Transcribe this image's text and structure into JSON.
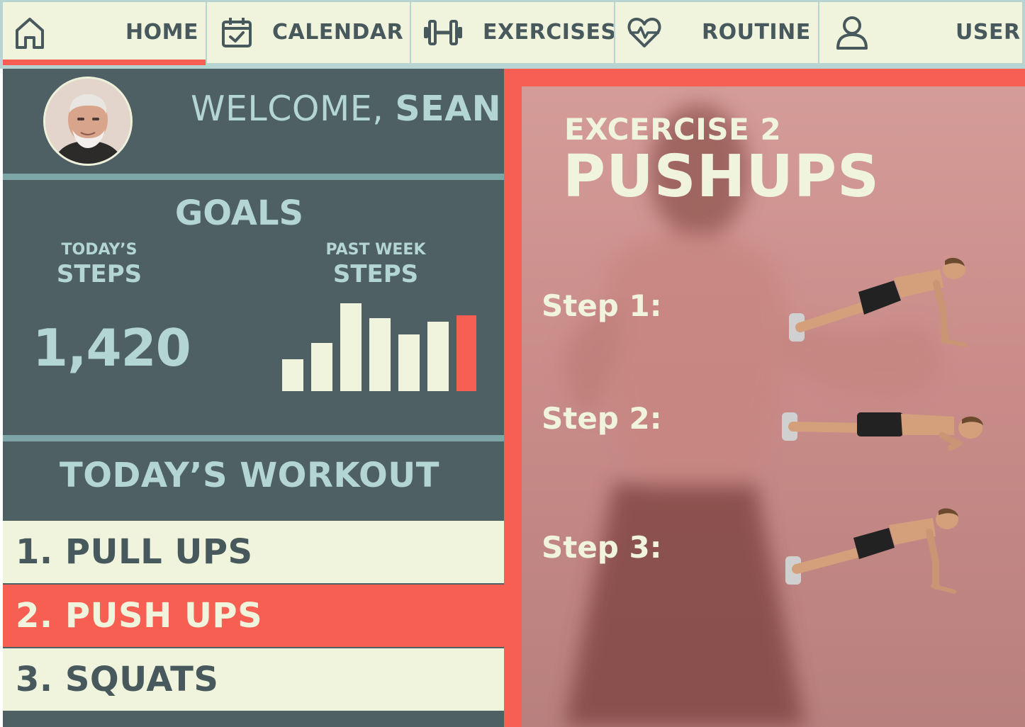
{
  "nav": {
    "tabs": [
      {
        "label": "HOME",
        "icon": "home-icon",
        "active": true
      },
      {
        "label": "CALENDAR",
        "icon": "calendar-check-icon",
        "active": false
      },
      {
        "label": "EXERCISES",
        "icon": "dumbbell-icon",
        "active": false
      },
      {
        "label": "ROUTINE",
        "icon": "heart-pulse-icon",
        "active": false
      },
      {
        "label": "USER",
        "icon": "user-icon",
        "active": false
      }
    ]
  },
  "welcome": {
    "greeting": "WELCOME, ",
    "name": "SEAN",
    "avatar": "user-photo"
  },
  "goals": {
    "title": "GOALS",
    "today_label_small": "TODAY’S",
    "today_label_big": "STEPS",
    "today_steps": "1,420",
    "week_label_small": "PAST WEEK",
    "week_label_big": "STEPS",
    "week_chart": {
      "type": "bar",
      "values": [
        45,
        68,
        124,
        103,
        80,
        98,
        107
      ],
      "highlight_index": 6,
      "bar_color": "#f1f4dc",
      "highlight_color": "#f75f52"
    }
  },
  "workout": {
    "title": "TODAY’S WORKOUT",
    "items": [
      {
        "label": "1. PULL UPS",
        "active": false
      },
      {
        "label": "2. PUSH UPS",
        "active": true
      },
      {
        "label": "3. SQUATS",
        "active": false
      }
    ]
  },
  "exercise": {
    "number_label": "EXCERCISE 2",
    "name": "PUSHUPS",
    "steps": [
      {
        "label": "Step 1:",
        "pose": "plank-high"
      },
      {
        "label": "Step 2:",
        "pose": "plank-low"
      },
      {
        "label": "Step 3:",
        "pose": "plank-high"
      }
    ]
  },
  "colors": {
    "accent": "#f75f52",
    "panel_dark": "#4f6065",
    "cream": "#f1f4dc",
    "text_light": "#b3d5d3",
    "text_dark": "#48595e"
  }
}
